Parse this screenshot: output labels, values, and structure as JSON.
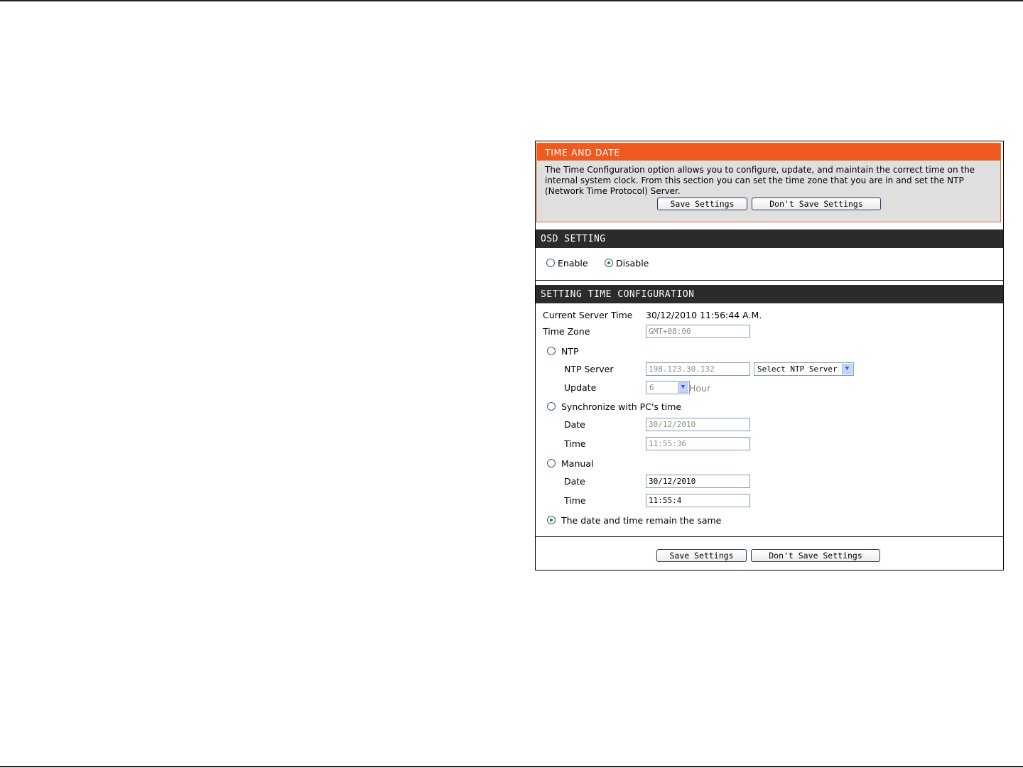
{
  "time_and_date": {
    "title": "TIME AND DATE",
    "description": "The Time Configuration option allows you to configure, update, and maintain the correct time on the internal system clock. From this section you can set the time zone that you are in and set the NTP (Network Time Protocol) Server.",
    "save_label": "Save Settings",
    "dont_save_label": "Don't Save Settings"
  },
  "osd_setting": {
    "title": "OSD SETTING",
    "enable_label": "Enable",
    "disable_label": "Disable",
    "selected": "Disable"
  },
  "time_config": {
    "title": "SETTING TIME CONFIGURATION",
    "current_server_time_label": "Current Server Time",
    "current_server_time_value": "30/12/2010 11:56:44 A.M.",
    "time_zone_label": "Time Zone",
    "time_zone_value": "GMT+08:00",
    "ntp_label": "NTP",
    "ntp_server_label": "NTP Server",
    "ntp_server_value": "198.123.30.132",
    "select_ntp_server_label": "Select NTP Server",
    "update_label": "Update",
    "update_value": "6",
    "update_unit": "Hour",
    "sync_pc_label": "Synchronize with PC's time",
    "pc_date_label": "Date",
    "pc_date_value": "30/12/2010",
    "pc_time_label": "Time",
    "pc_time_value": "11:55:36",
    "manual_label": "Manual",
    "manual_date_label": "Date",
    "manual_date_value": "30/12/2010",
    "manual_time_label": "Time",
    "manual_time_value": "11:55:4",
    "remain_same_label": "The date and time remain the same",
    "selected_mode": "The date and time remain the same"
  },
  "footer": {
    "save_label": "Save Settings",
    "dont_save_label": "Don't Save Settings"
  },
  "icons": {
    "radio": "radio-button-icon",
    "dropdown": "chevron-down-icon"
  },
  "colors": {
    "header_orange": "#f15a1f",
    "section_header_dark": "#2b2b2b",
    "info_box_bg": "#dfdfdf"
  }
}
